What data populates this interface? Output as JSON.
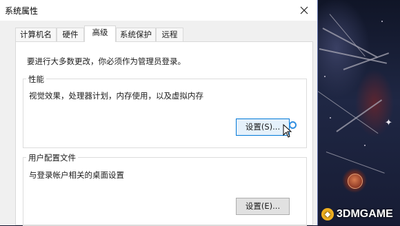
{
  "window": {
    "title": "系统属性"
  },
  "tabs": [
    {
      "label": "计算机名",
      "active": false
    },
    {
      "label": "硬件",
      "active": false
    },
    {
      "label": "高级",
      "active": true
    },
    {
      "label": "系统保护",
      "active": false
    },
    {
      "label": "远程",
      "active": false
    }
  ],
  "content": {
    "admin_note": "要进行大多数更改，你必须作为管理员登录。",
    "performance": {
      "title": "性能",
      "description": "视觉效果，处理器计划，内存使用，以及虚拟内存",
      "button": "设置(S)..."
    },
    "user_profiles": {
      "title": "用户配置文件",
      "description": "与登录帐户相关的桌面设置",
      "button": "设置(E)..."
    }
  },
  "watermark": {
    "text": "3DMGAME"
  },
  "icons": {
    "close": "close-icon",
    "cursor": "mouse-pointer-icon",
    "click": "click-indicator-icon",
    "logo": "3dm-logo-icon"
  },
  "colors": {
    "accent": "#0078d7",
    "click_ring": "#2f8ee0",
    "button_face": "#e1e1e1"
  }
}
